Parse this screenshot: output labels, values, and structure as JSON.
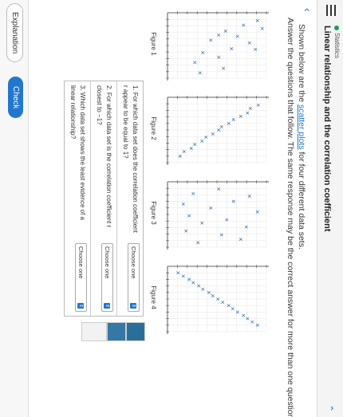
{
  "header": {
    "section": "Statistics",
    "title": "Linear relationship and the correlation coefficient"
  },
  "intro": {
    "line1_prefix": "Shown below are the ",
    "link": "scatter plots",
    "line1_suffix": " for four different data sets.",
    "line2": "Answer the questions that follow. The same response may be the correct answer for more than one question."
  },
  "figures": [
    {
      "label": "Figure 1",
      "points": [
        [
          1.2,
          9.1
        ],
        [
          1.9,
          7.7
        ],
        [
          2.4,
          9.6
        ],
        [
          2.8,
          5.9
        ],
        [
          3.6,
          7.1
        ],
        [
          4.2,
          4.4
        ],
        [
          4.6,
          8.3
        ],
        [
          5.5,
          6.5
        ],
        [
          6.1,
          3.6
        ],
        [
          6.8,
          5.2
        ],
        [
          7.6,
          2.8
        ],
        [
          8.5,
          5.7
        ],
        [
          9.2,
          3.3
        ],
        [
          3.4,
          5.2
        ],
        [
          5.6,
          8.9
        ]
      ]
    },
    {
      "label": "Figure 2",
      "points": [
        [
          1.2,
          9.2
        ],
        [
          1.7,
          8.4
        ],
        [
          2.4,
          8.1
        ],
        [
          2.9,
          7.4
        ],
        [
          3.4,
          6.7
        ],
        [
          4.0,
          6.2
        ],
        [
          4.5,
          5.5
        ],
        [
          5.0,
          5.2
        ],
        [
          5.6,
          4.6
        ],
        [
          6.1,
          3.9
        ],
        [
          6.7,
          3.5
        ],
        [
          7.2,
          2.8
        ],
        [
          7.8,
          2.4
        ],
        [
          8.3,
          1.7
        ],
        [
          9.0,
          1.3
        ]
      ]
    },
    {
      "label": "Figure 3",
      "points": [
        [
          1.1,
          5.2
        ],
        [
          1.8,
          2.6
        ],
        [
          2.2,
          8.3
        ],
        [
          3.0,
          6.7
        ],
        [
          3.4,
          1.6
        ],
        [
          4.0,
          4.4
        ],
        [
          4.6,
          9.1
        ],
        [
          5.2,
          2.2
        ],
        [
          5.8,
          6.0
        ],
        [
          6.3,
          3.5
        ],
        [
          6.9,
          8.0
        ],
        [
          7.5,
          1.9
        ],
        [
          8.1,
          5.5
        ],
        [
          8.8,
          7.4
        ],
        [
          9.3,
          3.1
        ]
      ]
    },
    {
      "label": "Figure 4",
      "points": [
        [
          1.0,
          1.1
        ],
        [
          1.5,
          1.6
        ],
        [
          2.0,
          2.2
        ],
        [
          2.5,
          2.6
        ],
        [
          3.0,
          3.2
        ],
        [
          3.5,
          3.6
        ],
        [
          4.0,
          4.2
        ],
        [
          4.5,
          4.6
        ],
        [
          5.0,
          5.1
        ],
        [
          5.5,
          5.6
        ],
        [
          6.0,
          6.2
        ],
        [
          6.5,
          6.6
        ],
        [
          7.0,
          7.1
        ],
        [
          7.5,
          7.7
        ],
        [
          8.0,
          8.1
        ],
        [
          8.5,
          8.6
        ],
        [
          9.0,
          9.1
        ]
      ]
    }
  ],
  "chart_data": [
    {
      "type": "scatter",
      "title": "Figure 1",
      "xlim": [
        0,
        10
      ],
      "ylim": [
        0,
        10
      ]
    },
    {
      "type": "scatter",
      "title": "Figure 2",
      "xlim": [
        0,
        10
      ],
      "ylim": [
        0,
        10
      ]
    },
    {
      "type": "scatter",
      "title": "Figure 3",
      "xlim": [
        0,
        10
      ],
      "ylim": [
        0,
        10
      ]
    },
    {
      "type": "scatter",
      "title": "Figure 4",
      "xlim": [
        0,
        10
      ],
      "ylim": [
        0,
        10
      ]
    }
  ],
  "questions": [
    {
      "text": "1. For which data set does the correlation coefficient r appear to be equal to 1?",
      "select": "Choose one"
    },
    {
      "text": "2. For which data set is the correlation coefficient r closest to −1?",
      "select": "Choose one"
    },
    {
      "text": "3. Which data set shows the least evidence of a linear relationship?",
      "select": "Choose one"
    }
  ],
  "buttons": {
    "explanation": "Explanation",
    "check": "Check"
  },
  "colors": {
    "accent": "#2277cc",
    "section_dot": "#1a9e5a"
  }
}
